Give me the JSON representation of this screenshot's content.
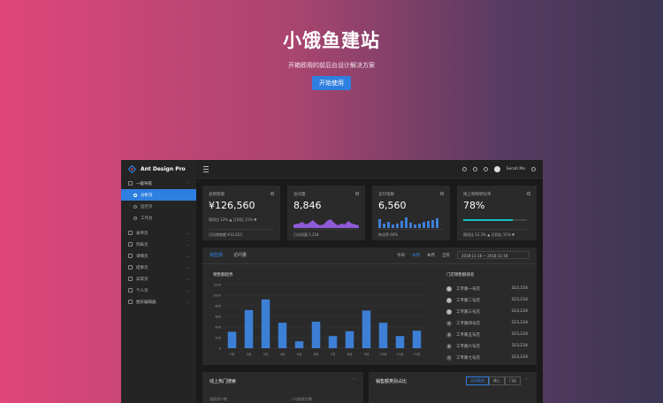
{
  "hero": {
    "title": "小饿鱼建站",
    "subtitle": "开箱即用的前后台设计解决方案",
    "cta": "开始使用"
  },
  "app": {
    "brand": "Ant Design Pro",
    "menu": {
      "dashboard_group": "一级导航",
      "dashboard_items": [
        "分析页",
        "监控页",
        "工作台"
      ],
      "groups": [
        "表单页",
        "列表页",
        "详情页",
        "结果页",
        "异常页",
        "个人页",
        "图形编辑器"
      ]
    },
    "header": {
      "user": "Serati Ma"
    },
    "stats": [
      {
        "label": "总销售额",
        "value": "¥126,560",
        "trend": "周同比 12% ▲  日同比 11% ▼",
        "foot": "日均销售额 ¥12,423"
      },
      {
        "label": "访问量",
        "value": "8,846",
        "foot": "日访问量 1,234"
      },
      {
        "label": "支付笔数",
        "value": "6,560",
        "foot": "转化率 60%"
      },
      {
        "label": "线上购物转化率",
        "value": "78%",
        "foot": "周同比 12.3% ▲  日同比 11% ▼",
        "progress": 0.78
      }
    ],
    "sales": {
      "tabs": [
        "销售额",
        "访问量"
      ],
      "periods": [
        "今日",
        "本周",
        "本月",
        "全年"
      ],
      "date_range": "2018-11-18 ~ 2018-11-18",
      "chart_title": "销售额趋势",
      "rank_title": "门店销售额排名",
      "ranking": [
        {
          "rank": "1",
          "name": "工专路一号店",
          "amount": "323,234"
        },
        {
          "rank": "2",
          "name": "工专路二号店",
          "amount": "323,234"
        },
        {
          "rank": "3",
          "name": "工专路三号店",
          "amount": "323,234"
        },
        {
          "rank": "4",
          "name": "工专路四号店",
          "amount": "323,234"
        },
        {
          "rank": "5",
          "name": "工专路五号店",
          "amount": "323,234"
        },
        {
          "rank": "6",
          "name": "工专路六号店",
          "amount": "323,234"
        },
        {
          "rank": "7",
          "name": "工专路七号店",
          "amount": "323,234"
        }
      ]
    },
    "search_card": {
      "title": "线上热门搜索",
      "label_a": "搜索用户数",
      "label_b": "人均搜索次数"
    },
    "share_card": {
      "title": "销售额类别占比",
      "seg": [
        "全部渠道",
        "线上",
        "门店"
      ]
    }
  },
  "chart_data": {
    "type": "bar",
    "categories": [
      "1月",
      "2月",
      "3月",
      "4月",
      "5月",
      "6月",
      "7月",
      "8月",
      "9月",
      "10月",
      "11月",
      "12月"
    ],
    "values": [
      310,
      720,
      920,
      480,
      130,
      500,
      230,
      320,
      710,
      480,
      230,
      330
    ],
    "ylim": [
      0,
      1200
    ],
    "yticks": [
      "0",
      "200",
      "400",
      "600",
      "800",
      "1000",
      "1200"
    ],
    "color": "#3d7fd6"
  },
  "colors": {
    "accent": "#2f7fe0",
    "card": "#2a2a2a",
    "bg": "#1a1a1a",
    "progress": "#13c2c2"
  }
}
